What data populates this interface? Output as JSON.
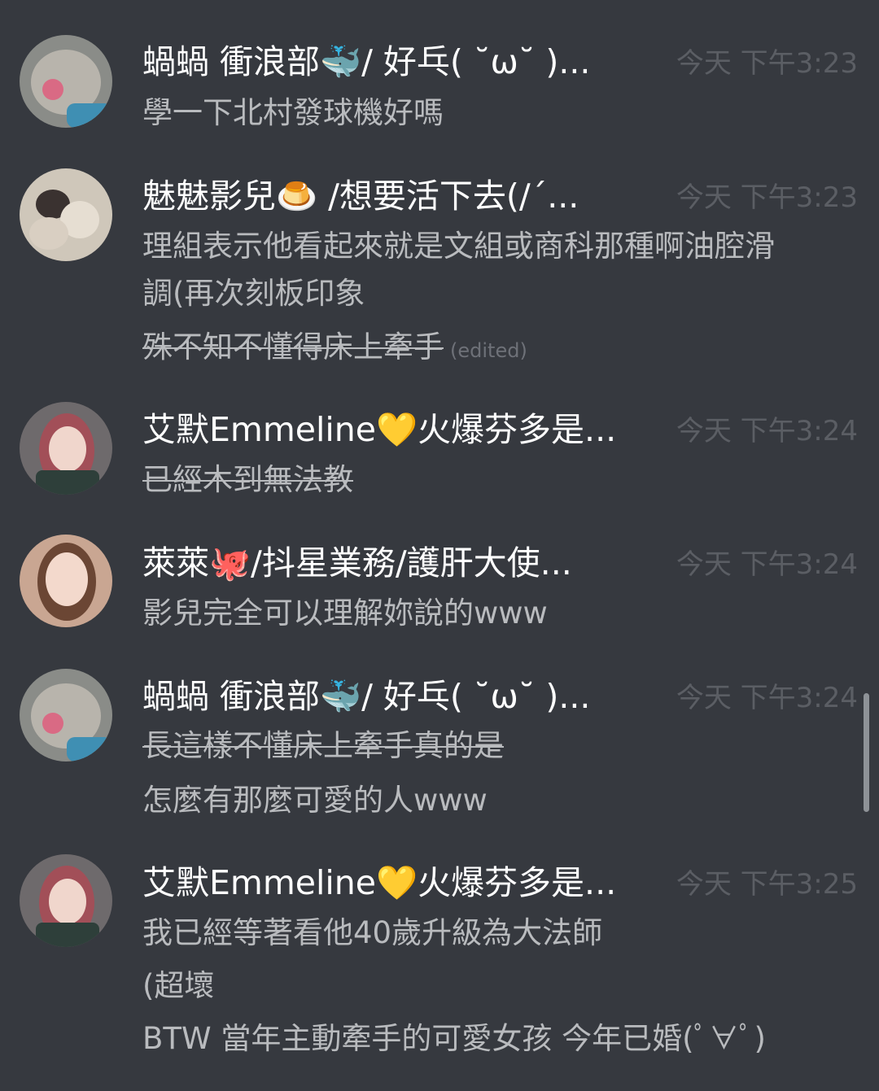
{
  "messages": [
    {
      "username": "蝸蝸 衝浪部🐳/ 好乓( ˘ω˘ )...",
      "timestamp": "今天 下午3:23",
      "lines": [
        {
          "text": "學一下北村發球機好嗎"
        }
      ]
    },
    {
      "username": "魅魅影兒🍮 /想要活下去(/´...",
      "timestamp": "今天 下午3:23",
      "lines": [
        {
          "text": "理組表示他看起來就是文組或商科那種啊油腔滑"
        },
        {
          "text": "調(再次刻板印象"
        },
        {
          "text": "殊不知不懂得床上牽手",
          "edited": "(edited)"
        }
      ]
    },
    {
      "username": "艾默Emmeline💛火爆芬多是...",
      "timestamp": "今天 下午3:24",
      "lines": [
        {
          "text": "已經木到無法教"
        }
      ]
    },
    {
      "username": "萊萊🐙/抖星業務/護肝大使...",
      "timestamp": "今天 下午3:24",
      "lines": [
        {
          "text": "影兒完全可以理解妳說的www"
        }
      ]
    },
    {
      "username": "蝸蝸 衝浪部🐳/ 好乓( ˘ω˘ )...",
      "timestamp": "今天 下午3:24",
      "lines": [
        {
          "text": "長這樣不懂床上牽手真的是"
        },
        {
          "text": "怎麼有那麼可愛的人www"
        }
      ]
    },
    {
      "username": "艾默Emmeline💛火爆芬多是...",
      "timestamp": "今天 下午3:25",
      "lines": [
        {
          "text": "我已經等著看他40歲升級為大法師"
        },
        {
          "text": "(超壞"
        },
        {
          "text": "BTW 當年主動牽手的可愛女孩 今年已婚(ﾟ∀ﾟ)"
        }
      ]
    }
  ],
  "colors": {
    "background": "#36393f",
    "username": "#ffffff",
    "message_text": "#b9bbbe",
    "timestamp": "#5b5e64",
    "scrollbar": "#8e9297"
  }
}
